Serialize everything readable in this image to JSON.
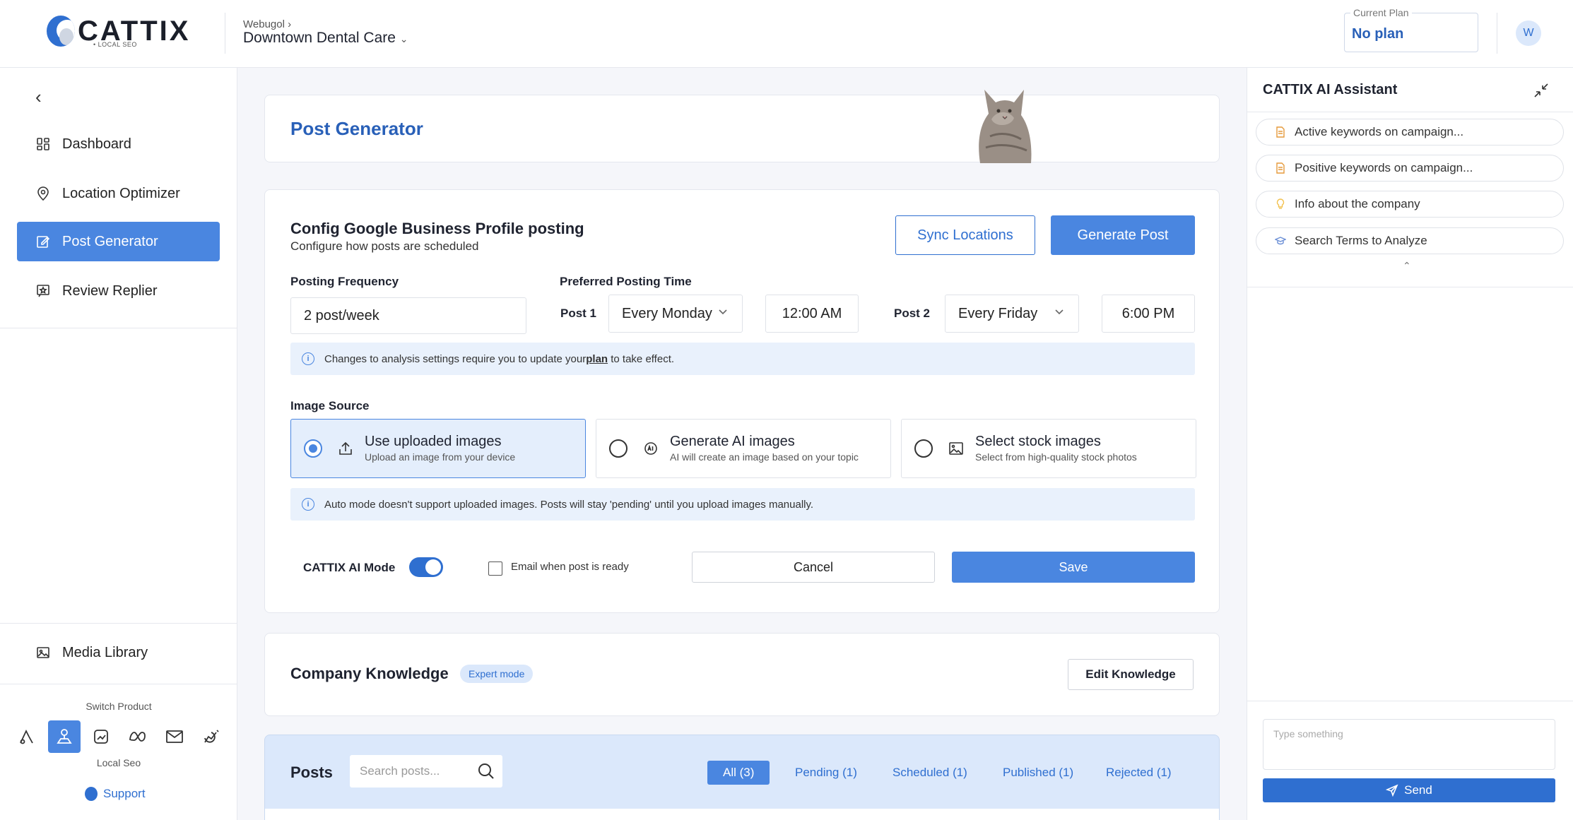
{
  "header": {
    "logo_text": "CATTIX",
    "logo_sub": "• LOCAL SEO",
    "breadcrumb_parent": "Webugol ›",
    "location": "Downtown Dental Care",
    "location_chevron": "⌄",
    "plan_label": "Current Plan",
    "plan_value": "No plan",
    "avatar_initial": "W"
  },
  "sidebar": {
    "collapse_glyph": "‹",
    "items": [
      {
        "label": "Dashboard",
        "icon": "dashboard-icon"
      },
      {
        "label": "Location Optimizer",
        "icon": "location-pin-icon"
      },
      {
        "label": "Post Generator",
        "icon": "edit-post-icon"
      },
      {
        "label": "Review Replier",
        "icon": "review-star-icon"
      }
    ],
    "media_library": "Media Library",
    "switch_product": "Switch Product",
    "current_product": "Local Seo",
    "support": "Support"
  },
  "main": {
    "page_title": "Post Generator",
    "config": {
      "title": "Config Google Business Profile posting",
      "subtitle": "Configure how posts are scheduled",
      "sync_button": "Sync Locations",
      "generate_button": "Generate Post",
      "frequency_label": "Posting Frequency",
      "frequency_value": "2 post/week",
      "preferred_time_label": "Preferred Posting Time",
      "post1_label": "Post 1",
      "post1_day": "Every Monday",
      "post1_time": "12:00 AM",
      "post2_label": "Post 2",
      "post2_day": "Every Friday",
      "post2_time": "6:00 PM",
      "notice_before": "Changes to analysis settings require you to update your ",
      "notice_link": "plan",
      "notice_after": " to take effect.",
      "image_source_label": "Image Source",
      "sources": [
        {
          "title": "Use uploaded images",
          "desc": "Upload an image from your device"
        },
        {
          "title": "Generate AI images",
          "desc": "AI will create an image based on your topic"
        },
        {
          "title": "Select stock images",
          "desc": "Select from high-quality stock photos"
        }
      ],
      "auto_notice": "Auto mode doesn't support uploaded images. Posts will stay 'pending' until you upload images manually.",
      "ai_mode_label": "CATTIX AI Mode",
      "email_label": "Email when post is ready",
      "cancel_button": "Cancel",
      "save_button": "Save"
    },
    "knowledge": {
      "title": "Company Knowledge",
      "badge": "Expert mode",
      "edit_button": "Edit Knowledge"
    },
    "posts": {
      "title": "Posts",
      "search_placeholder": "Search posts...",
      "tabs": [
        "All (3)",
        "Pending (1)",
        "Scheduled (1)",
        "Published (1)",
        "Rejected (1)"
      ]
    }
  },
  "assistant": {
    "title": "CATTIX AI Assistant",
    "chips": [
      "Active keywords on campaign...",
      "Positive keywords on campaign...",
      "Info about the company",
      "Search Terms to Analyze"
    ],
    "collapse_glyph": "⌃",
    "input_placeholder": "Type something",
    "send_button": "Send"
  },
  "colors": {
    "primary": "#4a86e0",
    "primary_dark": "#2f6fd0",
    "title_blue": "#2960b8",
    "info_bg": "#e9f1fc"
  }
}
